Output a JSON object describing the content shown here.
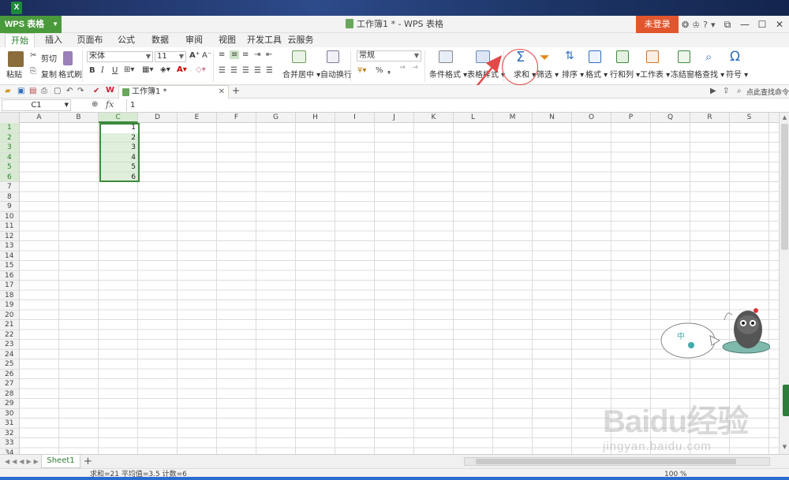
{
  "app": {
    "button_label": "WPS 表格",
    "window_title": "工作簿1 * - WPS 表格",
    "login_label": "未登录",
    "desktop_icon": "X"
  },
  "ribbon_tabs": [
    "开始",
    "插入",
    "页面布局",
    "公式",
    "数据",
    "审阅",
    "视图",
    "开发工具",
    "云服务"
  ],
  "ribbon": {
    "paste": "粘贴",
    "cut": "剪切",
    "copy": "复制",
    "format_painter": "格式刷",
    "font_name": "宋体",
    "font_size": "11",
    "bold": "B",
    "italic": "I",
    "underline": "U",
    "merge_center": "合并居中",
    "wrap_text": "自动换行",
    "number_format": "常规",
    "percent": "%",
    "conditional_format": "条件格式",
    "table_style": "表格样式",
    "sum": "求和",
    "filter": "筛选",
    "sort": "排序",
    "format": "格式",
    "rows_cols": "行和列",
    "worksheet": "工作表",
    "freeze": "冻结窗格",
    "find": "查找",
    "symbol": "符号"
  },
  "quick": {
    "doc_tab": "工作簿1 *",
    "search_cmd": "点此查找命令"
  },
  "formula_bar": {
    "name_box": "C1",
    "fx": "fx",
    "value": "1"
  },
  "columns": [
    "A",
    "B",
    "C",
    "D",
    "E",
    "F",
    "G",
    "H",
    "I",
    "J",
    "K",
    "L",
    "M",
    "N",
    "O",
    "P",
    "Q",
    "R",
    "S"
  ],
  "rows": [
    "1",
    "2",
    "3",
    "4",
    "5",
    "6",
    "7",
    "8",
    "9",
    "10",
    "11",
    "12",
    "13",
    "14",
    "15",
    "16",
    "17",
    "18",
    "19",
    "20",
    "21",
    "22",
    "23",
    "24",
    "25",
    "26",
    "27",
    "28",
    "29",
    "30",
    "31",
    "32",
    "33",
    "34"
  ],
  "cells_c": [
    "1",
    "2",
    "3",
    "4",
    "5",
    "6"
  ],
  "sheet": {
    "tab": "Sheet1",
    "add": "+"
  },
  "status": {
    "text": "求和=21  平均值=3.5  计数=6",
    "zoom": "100 %"
  },
  "mascot": {
    "bubble_text": "中"
  },
  "watermark": {
    "main": "Baidu经验",
    "sub": "jingyan.baidu.com"
  },
  "colors": {
    "accent_green": "#4a9a3c",
    "login_red": "#e2562e",
    "annotation_red": "#e24a4a"
  }
}
